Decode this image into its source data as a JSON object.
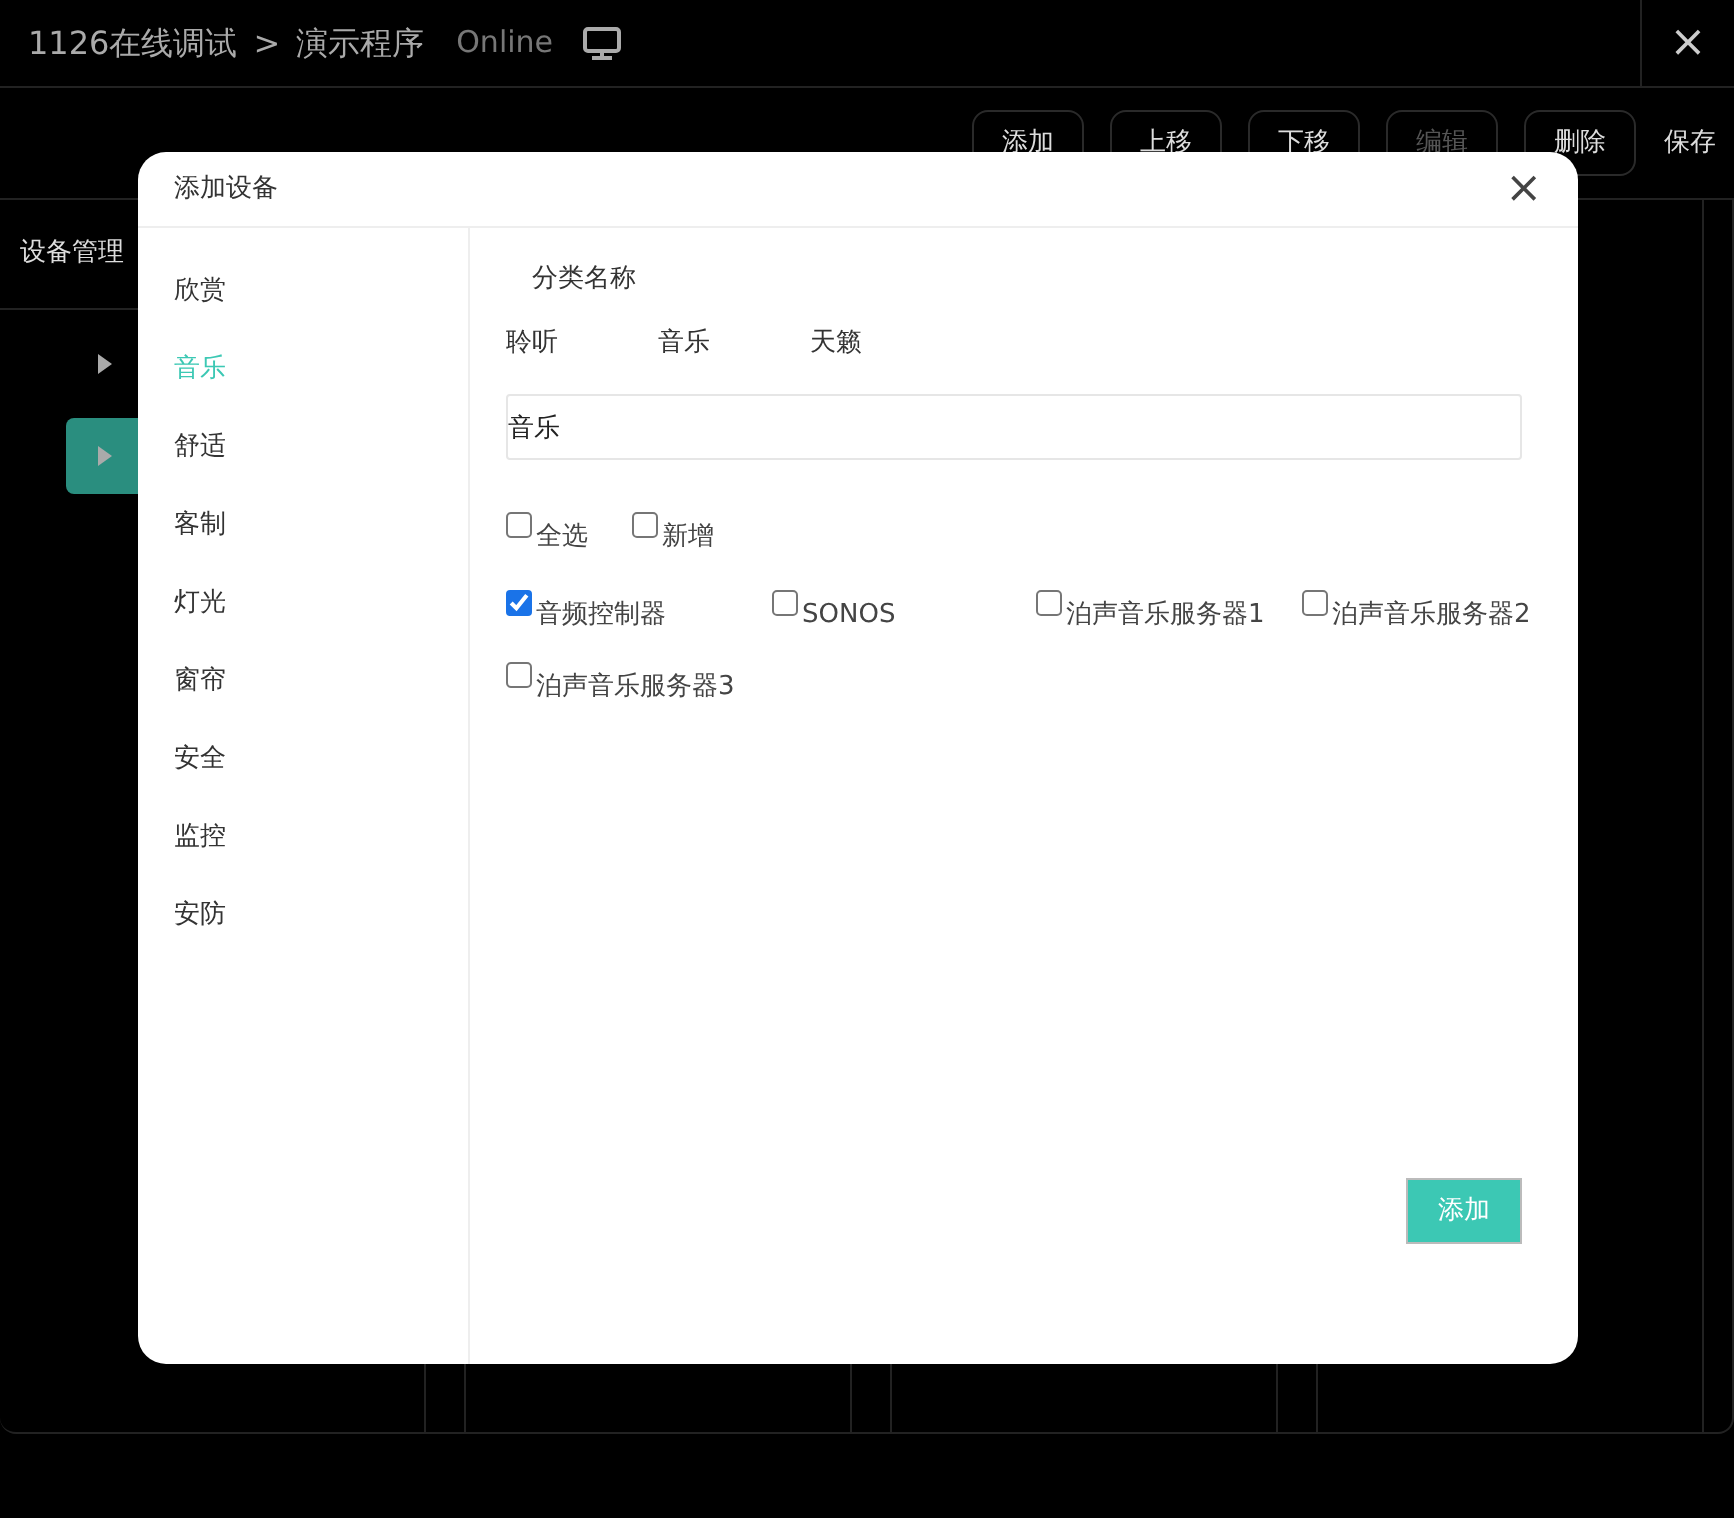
{
  "header": {
    "breadcrumb": [
      "1126在线调试",
      "演示程序"
    ],
    "separator": ">",
    "status": "Online",
    "close": "×"
  },
  "toolbar": {
    "buttons": [
      {
        "label": "添加",
        "disabled": false
      },
      {
        "label": "上移",
        "disabled": false
      },
      {
        "label": "下移",
        "disabled": false
      },
      {
        "label": "编辑",
        "disabled": true
      },
      {
        "label": "删除",
        "disabled": false
      },
      {
        "label": "保存",
        "disabled": false
      }
    ]
  },
  "sidebar": {
    "title": "设备管理",
    "items": [
      {
        "selected": false
      },
      {
        "selected": true
      }
    ]
  },
  "dialog": {
    "title": "添加设备",
    "close": "×",
    "categories": [
      {
        "label": "欣赏",
        "selected": false
      },
      {
        "label": "音乐",
        "selected": true
      },
      {
        "label": "舒适",
        "selected": false
      },
      {
        "label": "客制",
        "selected": false
      },
      {
        "label": "灯光",
        "selected": false
      },
      {
        "label": "窗帘",
        "selected": false
      },
      {
        "label": "安全",
        "selected": false
      },
      {
        "label": "监控",
        "selected": false
      },
      {
        "label": "安防",
        "selected": false
      }
    ],
    "name_label": "分类名称",
    "suggestions": [
      "聆听",
      "音乐",
      "天籁"
    ],
    "name_value": "音乐",
    "options": [
      {
        "label": "全选",
        "checked": false
      },
      {
        "label": "新增",
        "checked": false
      }
    ],
    "devices": [
      {
        "label": "音频控制器",
        "checked": true
      },
      {
        "label": "SONOS",
        "checked": false
      },
      {
        "label": "泊声音乐服务器1",
        "checked": false
      },
      {
        "label": "泊声音乐服务器2",
        "checked": false
      },
      {
        "label": "泊声音乐服务器3",
        "checked": false
      }
    ],
    "submit": "添加"
  }
}
